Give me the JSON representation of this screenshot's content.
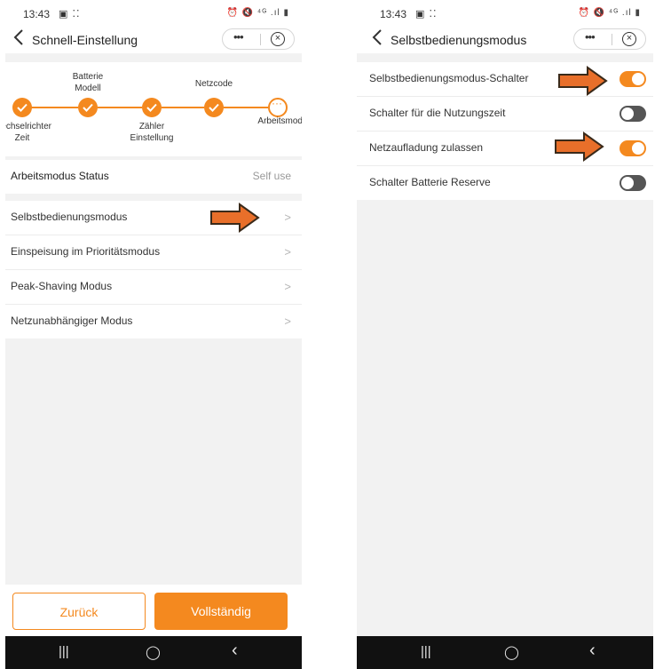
{
  "status_bar": {
    "time": "13:43",
    "left_icons": "▣ ⁚⁚",
    "right_icons": "⏰ 🔇 ⁴ᴳ .ıl ▮"
  },
  "colors": {
    "accent": "#f4891f",
    "toggle_off": "#555555",
    "arrow_fill": "#e86f2a",
    "arrow_stroke": "#3a2a1a"
  },
  "capsule": {
    "more": "•••",
    "close": "×"
  },
  "left_screen": {
    "title": "Schnell-Einstellung",
    "steps": [
      {
        "label": "Wechselrichter\nZeit",
        "status": "done"
      },
      {
        "label": "Batterie\nModell",
        "status": "done"
      },
      {
        "label": "Zähler\nEinstellung",
        "status": "done"
      },
      {
        "label": "Netzcode",
        "status": "done"
      },
      {
        "label": "Arbeitsmodus",
        "status": "pending"
      }
    ],
    "status_label": "Arbeitsmodus Status",
    "status_value": "Self use",
    "modes": [
      "Selbstbedienungsmodus",
      "Einspeisung im Prioritätsmodus",
      "Peak-Shaving Modus",
      "Netzunabhängiger Modus"
    ],
    "back_button": "Zurück",
    "done_button": "Vollständig"
  },
  "right_screen": {
    "title": "Selbstbedienungsmodus",
    "settings": [
      {
        "label": "Selbstbedienungsmodus-Schalter",
        "on": true
      },
      {
        "label": "Schalter für die Nutzungszeit",
        "on": false
      },
      {
        "label": "Netzaufladung zulassen",
        "on": true
      },
      {
        "label": "Schalter Batterie Reserve",
        "on": false
      }
    ]
  },
  "system_nav": {
    "recent": "|||",
    "home": "◯",
    "back": "‹"
  }
}
